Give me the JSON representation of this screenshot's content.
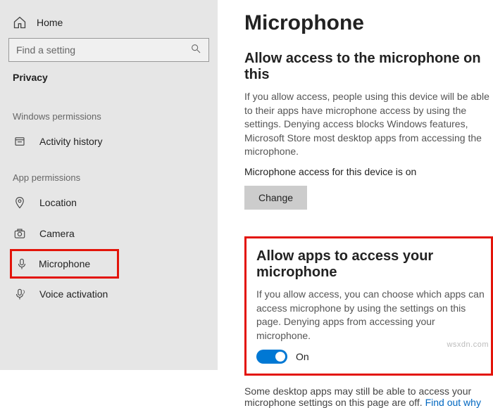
{
  "sidebar": {
    "home": "Home",
    "search_placeholder": "Find a setting",
    "category": "Privacy",
    "sections": {
      "windows_permissions": "Windows permissions",
      "app_permissions": "App permissions"
    },
    "items": {
      "activity_history": "Activity history",
      "location": "Location",
      "camera": "Camera",
      "microphone": "Microphone",
      "voice_activation": "Voice activation"
    }
  },
  "main": {
    "title": "Microphone",
    "section1": {
      "heading": "Allow access to the microphone on this",
      "body": "If you allow access, people using this device will be able to their apps have microphone access by using the settings. Denying access blocks Windows features, Microsoft Store most desktop apps from accessing the microphone.",
      "status": "Microphone access for this device is on",
      "button": "Change"
    },
    "section2": {
      "heading": "Allow apps to access your microphone",
      "body": "If you allow access, you can choose which apps can access microphone by using the settings on this page. Denying apps from accessing your microphone.",
      "toggle_state": "On"
    },
    "footnote": {
      "text": "Some desktop apps may still be able to access your microphone settings on this page are off. ",
      "link": "Find out why"
    }
  },
  "watermark": "wsxdn.com"
}
